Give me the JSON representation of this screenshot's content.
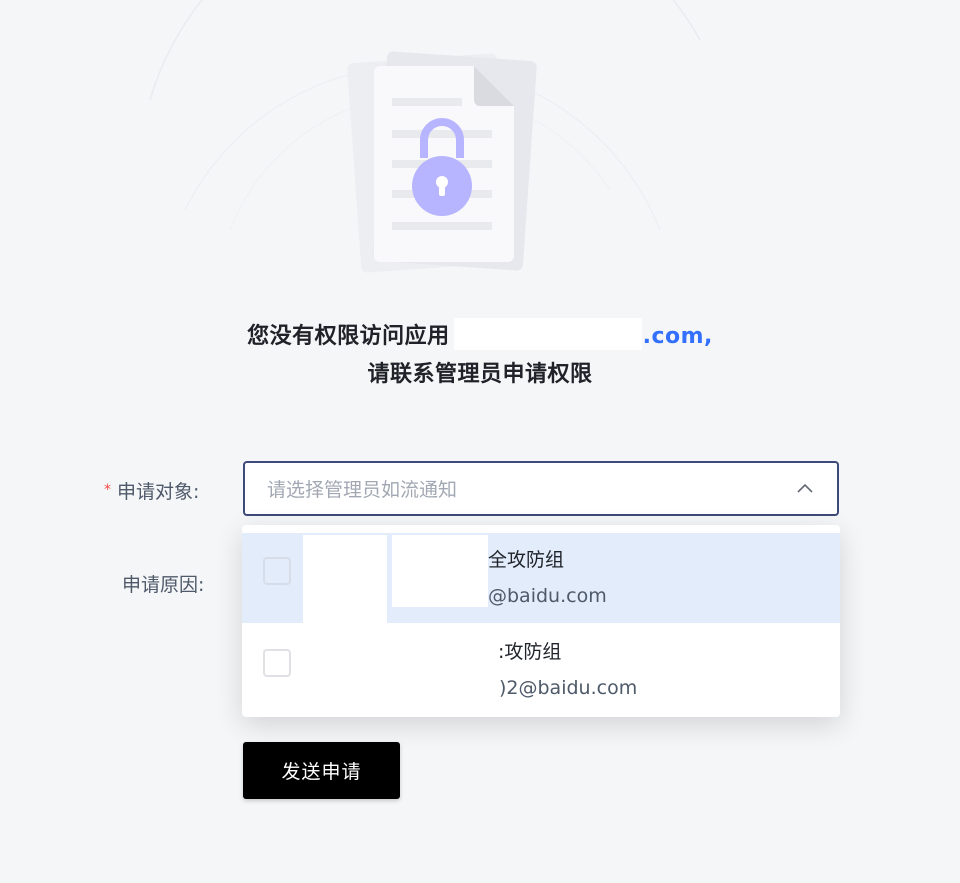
{
  "notice": {
    "line1_prefix": "您没有权限访问应用",
    "app_suffix": ".com,",
    "line2": "请联系管理员申请权限"
  },
  "form": {
    "target_label": "申请对象:",
    "target_placeholder": "请选择管理员如流通知",
    "reason_label": "申请原因:",
    "submit_label": "发送申请"
  },
  "dropdown": {
    "options": [
      {
        "group": "全攻防组",
        "email": "@baidu.com",
        "highlighted": true,
        "checked": false
      },
      {
        "group": ":攻防组",
        "email": ")2@baidu.com",
        "highlighted": false,
        "checked": false
      }
    ]
  },
  "colors": {
    "accent": "#3370ff",
    "lock": "#b7b5ff",
    "highlight": "#e3ecfb",
    "button": "#000000",
    "required": "#f54a45"
  },
  "icons": {
    "illustration": "locked-document-icon",
    "chevron": "chevron-up-icon"
  }
}
